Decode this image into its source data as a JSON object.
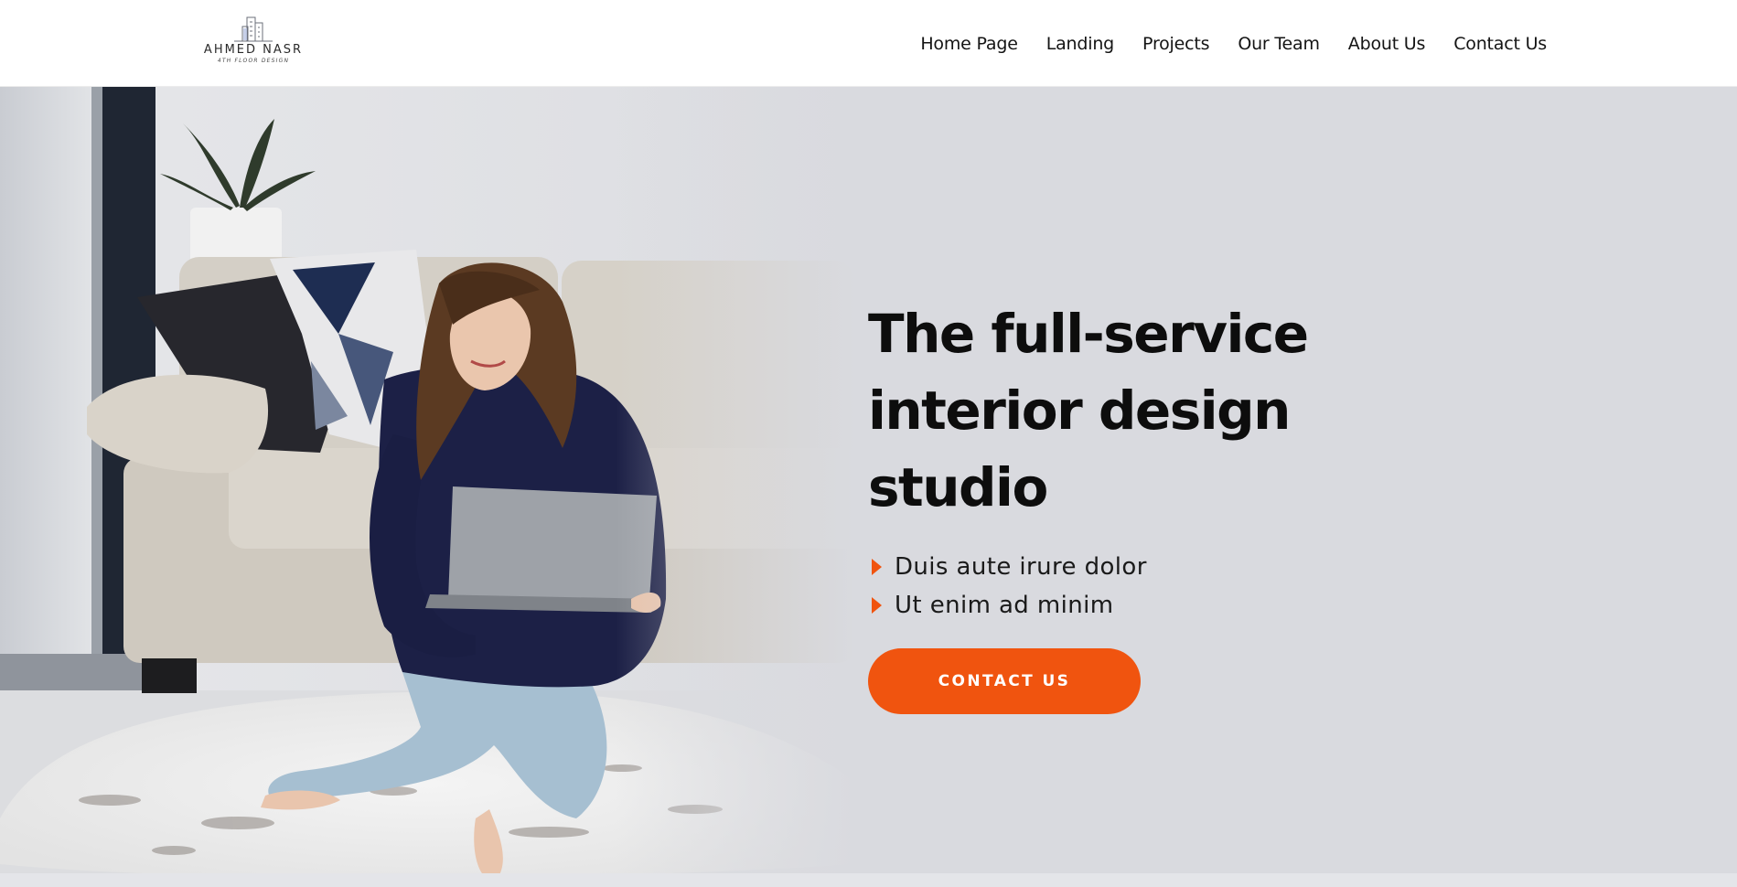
{
  "brand": {
    "name": "AHMED NASR",
    "tagline": "4TH FLOOR DESIGN",
    "logo_icon": "building-outline-icon"
  },
  "nav": {
    "items": [
      {
        "label": "Home Page"
      },
      {
        "label": "Landing"
      },
      {
        "label": "Projects"
      },
      {
        "label": "Our Team"
      },
      {
        "label": "About Us"
      },
      {
        "label": "Contact Us"
      }
    ]
  },
  "hero": {
    "title": "The full-service interior design studio",
    "bullets": [
      {
        "text": "Duis aute irure dolor",
        "icon": "caret-right-icon"
      },
      {
        "text": "Ut enim ad minim",
        "icon": "caret-right-icon"
      }
    ],
    "cta_label": "CONTACT US",
    "image_icon": "woman-on-rug-with-laptop-photo"
  },
  "colors": {
    "accent": "#f0540f",
    "hero_background": "#d9dadf",
    "header_background": "#ffffff",
    "text_dark": "#0d0d0d"
  }
}
